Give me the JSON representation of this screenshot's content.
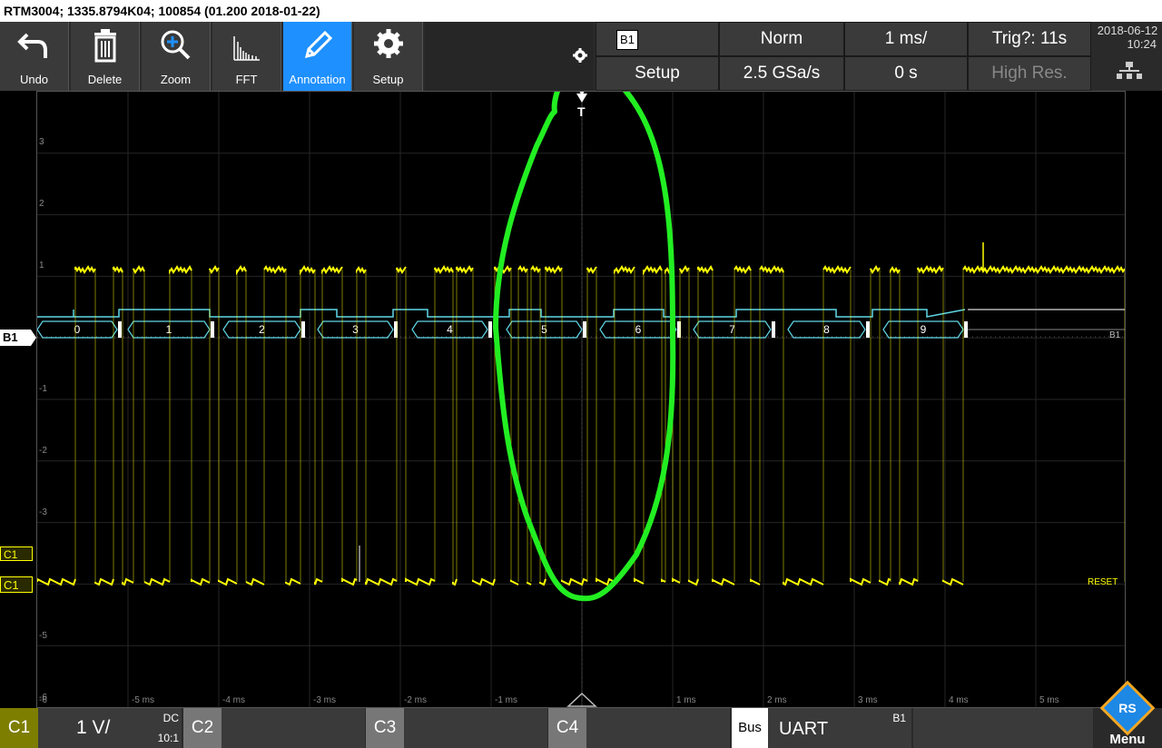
{
  "title_bar": "RTM3004; 1335.8794K04; 100854 (01.200 2018-01-22)",
  "toolbar": [
    {
      "label": "Undo",
      "icon": "undo-icon"
    },
    {
      "label": "Delete",
      "icon": "trash-icon"
    },
    {
      "label": "Zoom",
      "icon": "zoom-icon"
    },
    {
      "label": "FFT",
      "icon": "fft-icon"
    },
    {
      "label": "Annotation",
      "icon": "pencil-icon",
      "active": true
    },
    {
      "label": "Setup",
      "icon": "gear-icon"
    }
  ],
  "status": {
    "bus_badge": "B1",
    "bus_setup": "Setup",
    "trigger_mode": "Norm",
    "timebase": "1 ms/",
    "trigger_status": "Trig?: 11s",
    "sample_rate": "2.5 GSa/s",
    "time_offset": "0 s",
    "acq_mode": "High Res.",
    "date": "2018-06-12",
    "time": "10:24"
  },
  "plot": {
    "y_ticks": [
      "3",
      "2",
      "1",
      "-1",
      "-2",
      "-3",
      "-5",
      "-6"
    ],
    "x_ticks": [
      "-5 ms",
      "-4 ms",
      "-3 ms",
      "-2 ms",
      "-1 ms",
      "1 ms",
      "2 ms",
      "3 ms",
      "4 ms",
      "5 ms"
    ],
    "bus_labels": [
      "0",
      "1",
      "2",
      "3",
      "4",
      "5",
      "6",
      "7",
      "8",
      "9"
    ],
    "bus_right_label": "B1",
    "reset_label": "RESET",
    "trigger_marker": "T",
    "left_markers": {
      "bus": "B1",
      "c1_trigger": "C1",
      "c1": "C1"
    },
    "trace_color": "#ffff00",
    "bus_color": "#5fd8e8",
    "annotation_color": "#22ee22"
  },
  "bottom": {
    "c1_label": "C1",
    "c1_scale": "1 V/",
    "c1_coupling": "DC",
    "c1_probe": "10:1",
    "c2_label": "C2",
    "c3_label": "C3",
    "c4_label": "C4",
    "bus_label": "Bus",
    "bus_protocol": "UART",
    "bus_id": "B1",
    "menu_label": "Menu",
    "logo_text": "RS"
  }
}
